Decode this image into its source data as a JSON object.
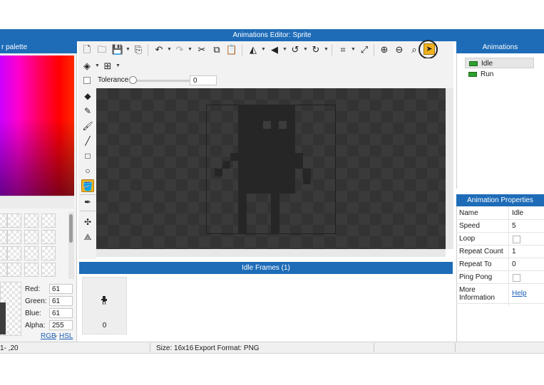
{
  "window": {
    "title": "Animations Editor: Sprite"
  },
  "color_panel": {
    "title": "r palette",
    "red_label": "Red:",
    "red_value": "61",
    "green_label": "Green:",
    "green_value": "61",
    "blue_label": "Blue:",
    "blue_value": "61",
    "alpha_label": "Alpha:",
    "alpha_value": "255",
    "rgb_link": "RGB",
    "link_separator": "-",
    "hsl_link": "HSL"
  },
  "tolerance": {
    "label": "Tolerance",
    "value": "0"
  },
  "frames_panel": {
    "title": "Idle Frames (1)",
    "frames": [
      {
        "number": "0"
      }
    ]
  },
  "animations_panel": {
    "title": "Animations",
    "items": [
      {
        "label": "Idle",
        "selected": true
      },
      {
        "label": "Run",
        "selected": false
      }
    ]
  },
  "properties_panel": {
    "title": "Animation Properties",
    "rows": [
      {
        "name": "Name",
        "value": "Idle"
      },
      {
        "name": "Speed",
        "value": "5"
      },
      {
        "name": "Loop",
        "value": ""
      },
      {
        "name": "Repeat Count",
        "value": "1"
      },
      {
        "name": "Repeat To",
        "value": "0"
      },
      {
        "name": "Ping Pong",
        "value": ""
      },
      {
        "name": "More Information",
        "value": "Help"
      }
    ]
  },
  "status_bar": {
    "coords": "20, -1",
    "size": "Size: 16x16",
    "export_format": "Export Format: PNG"
  },
  "colors": {
    "accent": "#1e6cb8",
    "active_tool": "#f0b21e",
    "sprite": "#262626",
    "canvas_bg": "#3a3a3a",
    "current_color": "#3d3d3d"
  }
}
